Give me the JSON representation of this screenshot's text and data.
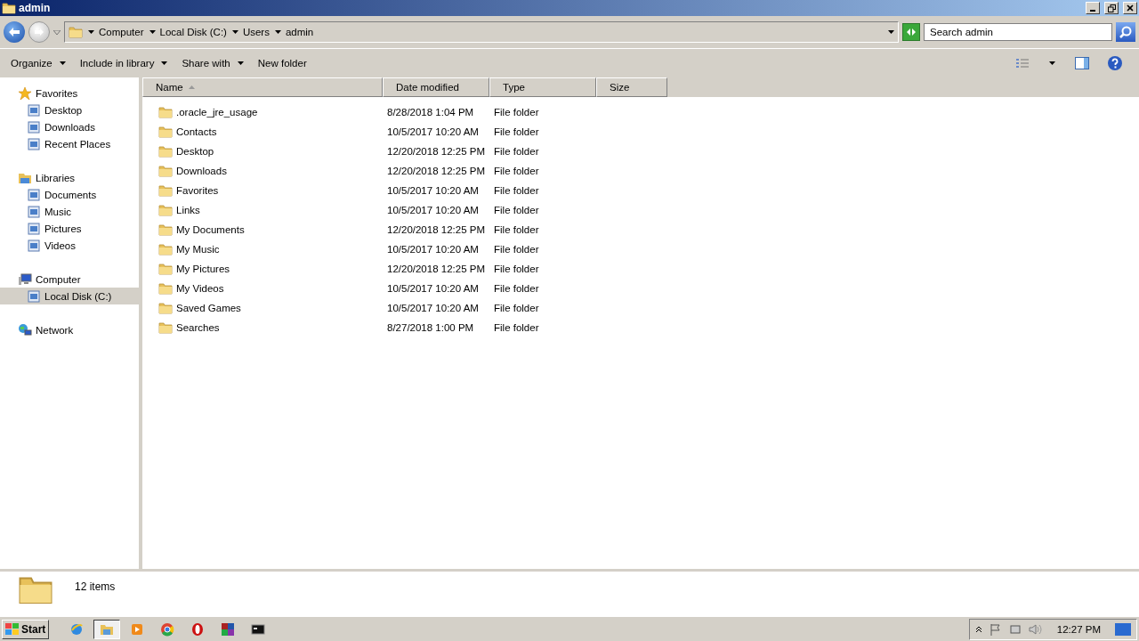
{
  "window": {
    "title": "admin"
  },
  "address": {
    "crumbs": [
      "Computer",
      "Local Disk (C:)",
      "Users",
      "admin"
    ]
  },
  "search": {
    "placeholder": "Search admin"
  },
  "toolbar": {
    "items": [
      {
        "label": "Organize",
        "dropdown": true
      },
      {
        "label": "Include in library",
        "dropdown": true
      },
      {
        "label": "Share with",
        "dropdown": true
      },
      {
        "label": "New folder",
        "dropdown": false
      }
    ]
  },
  "sidebar": {
    "groups": [
      {
        "label": "Favorites",
        "children": [
          {
            "label": "Desktop",
            "selected": false
          },
          {
            "label": "Downloads",
            "selected": false
          },
          {
            "label": "Recent Places",
            "selected": false
          }
        ]
      },
      {
        "label": "Libraries",
        "children": [
          {
            "label": "Documents",
            "selected": false
          },
          {
            "label": "Music",
            "selected": false
          },
          {
            "label": "Pictures",
            "selected": false
          },
          {
            "label": "Videos",
            "selected": false
          }
        ]
      },
      {
        "label": "Computer",
        "children": [
          {
            "label": "Local Disk (C:)",
            "selected": true
          }
        ]
      },
      {
        "label": "Network"
      }
    ]
  },
  "table": {
    "columns": [
      {
        "label": "Name",
        "sorted": true
      },
      {
        "label": "Date modified",
        "sorted": false
      },
      {
        "label": "Type",
        "sorted": false
      },
      {
        "label": "Size",
        "sorted": false
      }
    ],
    "rows": [
      {
        "name": ".oracle_jre_usage",
        "date": "8/28/2018 1:04 PM",
        "type": "File folder"
      },
      {
        "name": "Contacts",
        "date": "10/5/2017 10:20 AM",
        "type": "File folder"
      },
      {
        "name": "Desktop",
        "date": "12/20/2018 12:25 PM",
        "type": "File folder"
      },
      {
        "name": "Downloads",
        "date": "12/20/2018 12:25 PM",
        "type": "File folder"
      },
      {
        "name": "Favorites",
        "date": "10/5/2017 10:20 AM",
        "type": "File folder"
      },
      {
        "name": "Links",
        "date": "10/5/2017 10:20 AM",
        "type": "File folder"
      },
      {
        "name": "My Documents",
        "date": "12/20/2018 12:25 PM",
        "type": "File folder"
      },
      {
        "name": "My Music",
        "date": "10/5/2017 10:20 AM",
        "type": "File folder"
      },
      {
        "name": "My Pictures",
        "date": "12/20/2018 12:25 PM",
        "type": "File folder"
      },
      {
        "name": "My Videos",
        "date": "10/5/2017 10:20 AM",
        "type": "File folder"
      },
      {
        "name": "Saved Games",
        "date": "10/5/2017 10:20 AM",
        "type": "File folder"
      },
      {
        "name": "Searches",
        "date": "8/27/2018 1:00 PM",
        "type": "File folder"
      }
    ]
  },
  "status_bar": {
    "count": "12 items"
  },
  "taskbar": {
    "start": "Start",
    "apps": [
      {
        "active": false
      },
      {
        "active": true
      },
      {
        "active": false
      },
      {
        "active": false
      },
      {
        "active": false
      },
      {
        "active": false
      },
      {
        "active": false
      }
    ],
    "clock": "12:27 PM"
  }
}
